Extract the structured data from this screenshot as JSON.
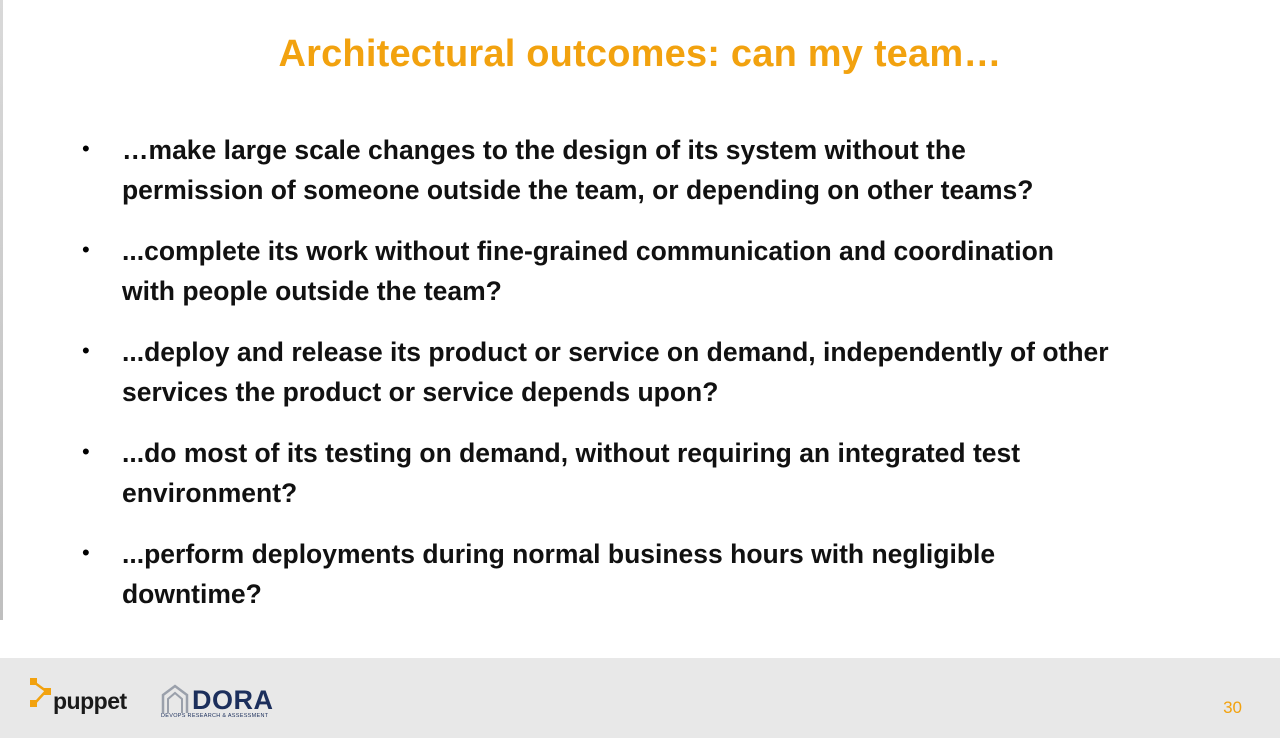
{
  "slide": {
    "title": "Architectural outcomes: can my team…",
    "bullet_symbol": "•",
    "bullets": [
      {
        "line1": "…make large scale changes to the design of its system without the",
        "line2": "permission of someone outside the team, or depending on other teams?"
      },
      {
        "line1": "...complete its work without fine-grained communication and coordination",
        "line2": "with people outside the team?"
      },
      {
        "line1": "...deploy and release its product or service on demand, independently of other",
        "line2": "services the product or service depends upon?"
      },
      {
        "line1": "...do most of its testing on demand, without requiring an integrated test",
        "line2": "environment?"
      },
      {
        "line1": "...perform deployments during normal business hours with negligible",
        "line2": "downtime?"
      }
    ]
  },
  "footer": {
    "puppet_logo_text": "puppet",
    "dora_logo_text": "DORA",
    "dora_subtitle": "DEVOPS RESEARCH & ASSESSMENT",
    "page_number": "30"
  },
  "colors": {
    "accent": "#f2a20f",
    "dora_navy": "#1c2f5c",
    "footer_bg": "#e8e8e8"
  },
  "icons": {
    "puppet": "puppet-logo-icon",
    "dora": "dora-house-icon"
  }
}
